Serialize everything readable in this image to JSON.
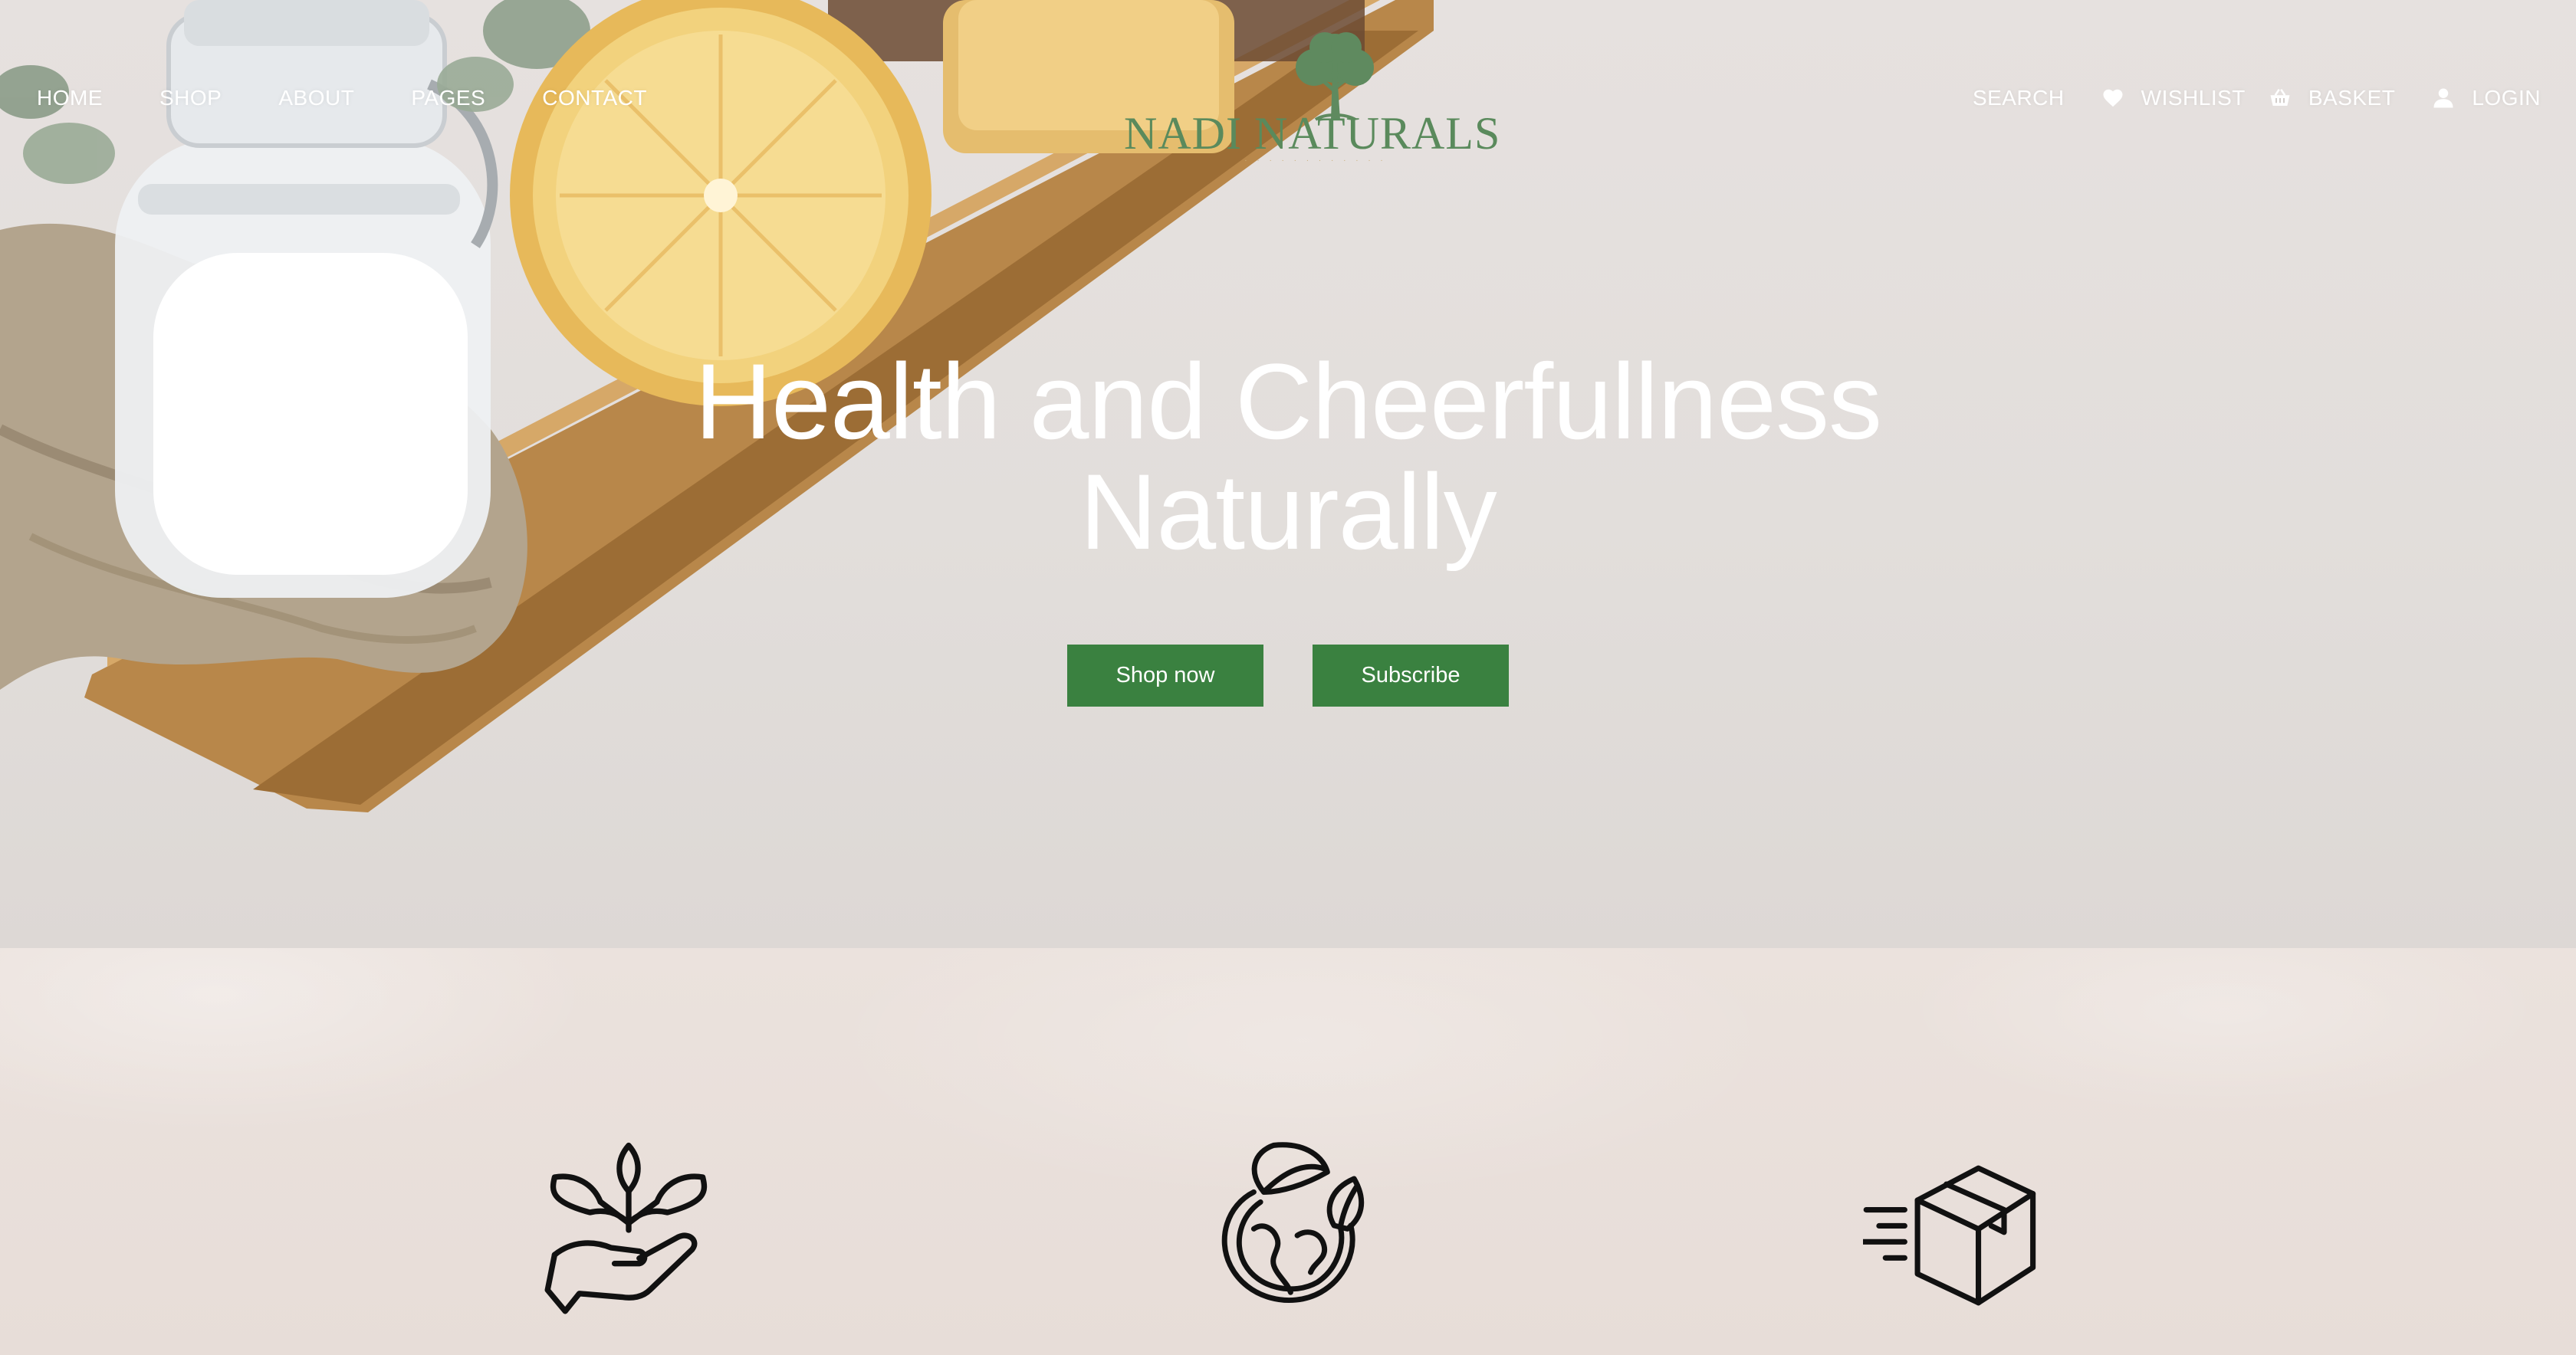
{
  "nav": {
    "left": [
      {
        "label": "HOME"
      },
      {
        "label": "SHOP"
      },
      {
        "label": "ABOUT"
      },
      {
        "label": "PAGES"
      },
      {
        "label": "CONTACT"
      }
    ],
    "search_label": "SEARCH",
    "wishlist_label": "WISHLIST",
    "basket_label": "BASKET",
    "login_label": "LOGIN"
  },
  "logo": {
    "name": "NADI NATURALS",
    "icon": "tree-icon"
  },
  "hero": {
    "headline_line1": "Health and Cheerfullness",
    "headline_line2": "Naturally",
    "shop_button": "Shop now",
    "subscribe_button": "Subscribe"
  },
  "features": [
    {
      "icon": "hand-plant-icon"
    },
    {
      "icon": "eco-globe-icon"
    },
    {
      "icon": "fast-delivery-box-icon"
    }
  ],
  "colors": {
    "accent_green": "#3a8140",
    "logo_green": "#5a8a5c",
    "nav_text": "#ffffff"
  }
}
